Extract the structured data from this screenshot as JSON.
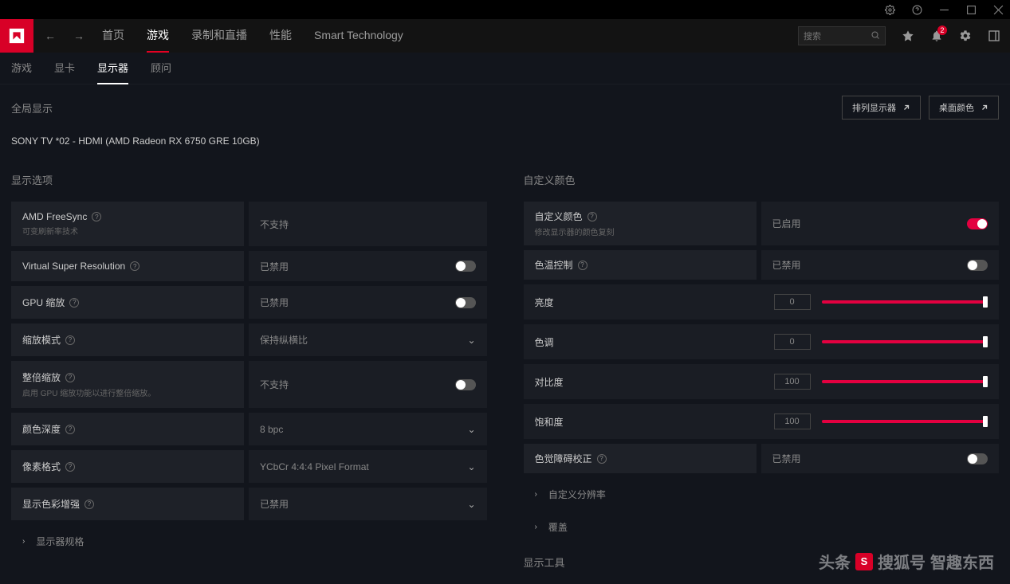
{
  "titlebar": {},
  "topnav": {
    "tabs": [
      "首页",
      "游戏",
      "录制和直播",
      "性能",
      "Smart Technology"
    ],
    "active_index": 1,
    "search_placeholder": "搜索",
    "notif_count": "2"
  },
  "subnav": {
    "tabs": [
      "游戏",
      "显卡",
      "显示器",
      "顾问"
    ],
    "active_index": 2
  },
  "header": {
    "title": "全局显示",
    "arrange_btn": "排列显示器",
    "color_btn": "桌面颜色"
  },
  "device": "SONY TV  *02 - HDMI (AMD Radeon RX 6750 GRE 10GB)",
  "left": {
    "section_title": "显示选项",
    "rows": {
      "freesync": {
        "label": "AMD FreeSync",
        "sub": "可变刷新率技术",
        "value": "不支持"
      },
      "vsr": {
        "label": "Virtual Super Resolution",
        "value": "已禁用"
      },
      "gpuscale": {
        "label": "GPU 缩放",
        "value": "已禁用"
      },
      "scalemode": {
        "label": "缩放模式",
        "value": "保持纵横比"
      },
      "intscale": {
        "label": "整倍缩放",
        "sub": "启用 GPU 缩放功能以进行整倍缩放。",
        "value": "不支持"
      },
      "colordepth": {
        "label": "颜色深度",
        "value": "8 bpc"
      },
      "pixelformat": {
        "label": "像素格式",
        "value": "YCbCr 4:4:4 Pixel Format"
      },
      "colorenhance": {
        "label": "显示色彩增强",
        "value": "已禁用"
      }
    },
    "expand_specs": "显示器规格"
  },
  "right": {
    "section_title": "自定义颜色",
    "customcolor": {
      "label": "自定义颜色",
      "sub": "修改显示器的颜色复刻",
      "value": "已启用"
    },
    "tempctrl": {
      "label": "色温控制",
      "value": "已禁用"
    },
    "sliders": {
      "brightness": {
        "label": "亮度",
        "value": "0"
      },
      "hue": {
        "label": "色调",
        "value": "0"
      },
      "contrast": {
        "label": "对比度",
        "value": "100"
      },
      "saturation": {
        "label": "饱和度",
        "value": "100"
      }
    },
    "cvd": {
      "label": "色觉障碍校正",
      "value": "已禁用"
    },
    "expand_resolution": "自定义分辨率",
    "expand_override": "覆盖",
    "tools_title": "显示工具"
  },
  "watermark": {
    "brand": "搜狐号",
    "author": "智趣东西",
    "headline": "头条"
  }
}
